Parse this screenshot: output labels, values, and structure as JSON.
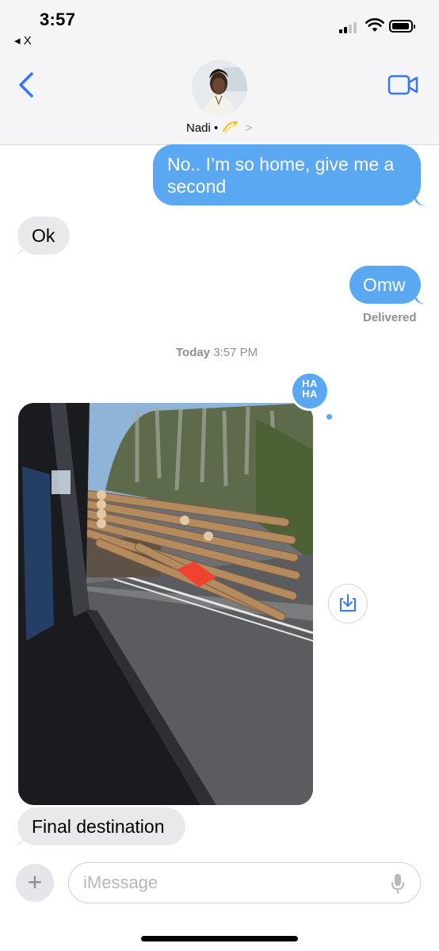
{
  "status_bar": {
    "time": "3:57",
    "back_app": "◂ X"
  },
  "header": {
    "contact_name": "Nadi",
    "contact_separator": "•",
    "contact_chevron": ">"
  },
  "messages": [
    {
      "direction": "outgoing",
      "text": "No.. I’m so home, give me a second"
    },
    {
      "direction": "incoming",
      "text": "Ok"
    },
    {
      "direction": "outgoing",
      "text": "Omw"
    },
    {
      "direction": "incoming",
      "text": "Final destination"
    }
  ],
  "delivered_label": "Delivered",
  "timestamp": {
    "day": "Today",
    "time": "3:57 PM"
  },
  "tapback": {
    "line1": "HA",
    "line2": "HA"
  },
  "compose": {
    "placeholder": "iMessage",
    "plus": "+"
  },
  "colors": {
    "outgoing_bubble": "#5aa8f2",
    "incoming_bubble": "#e9e9eb",
    "accent": "#3478f6"
  },
  "icons": [
    "back-chevron-icon",
    "facetime-video-icon",
    "save-image-icon",
    "microphone-icon",
    "plus-icon"
  ]
}
